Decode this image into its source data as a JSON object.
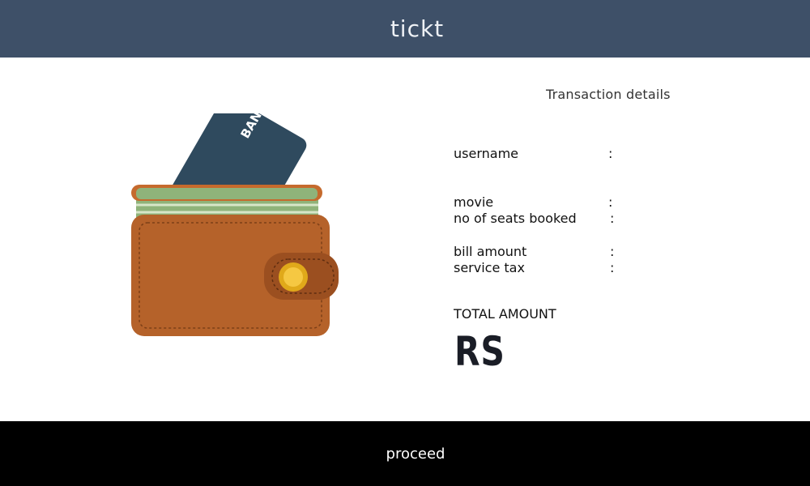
{
  "header": {
    "title": "tickt"
  },
  "wallet": {
    "card_text": "BANK"
  },
  "details": {
    "title": "Transaction details",
    "separator": ":",
    "rows": [
      {
        "label": "username"
      },
      {
        "label": "movie"
      },
      {
        "label": "no of seats booked"
      },
      {
        "label": "bill amount"
      },
      {
        "label": "service tax"
      }
    ],
    "total_label": "TOTAL AMOUNT",
    "currency": "RS"
  },
  "footer": {
    "proceed_label": "proceed"
  },
  "colors": {
    "header_bg": "#3e5068",
    "footer_bg": "#000000",
    "wallet_brown": "#b5622a",
    "card_blue": "#2f4a5e"
  }
}
